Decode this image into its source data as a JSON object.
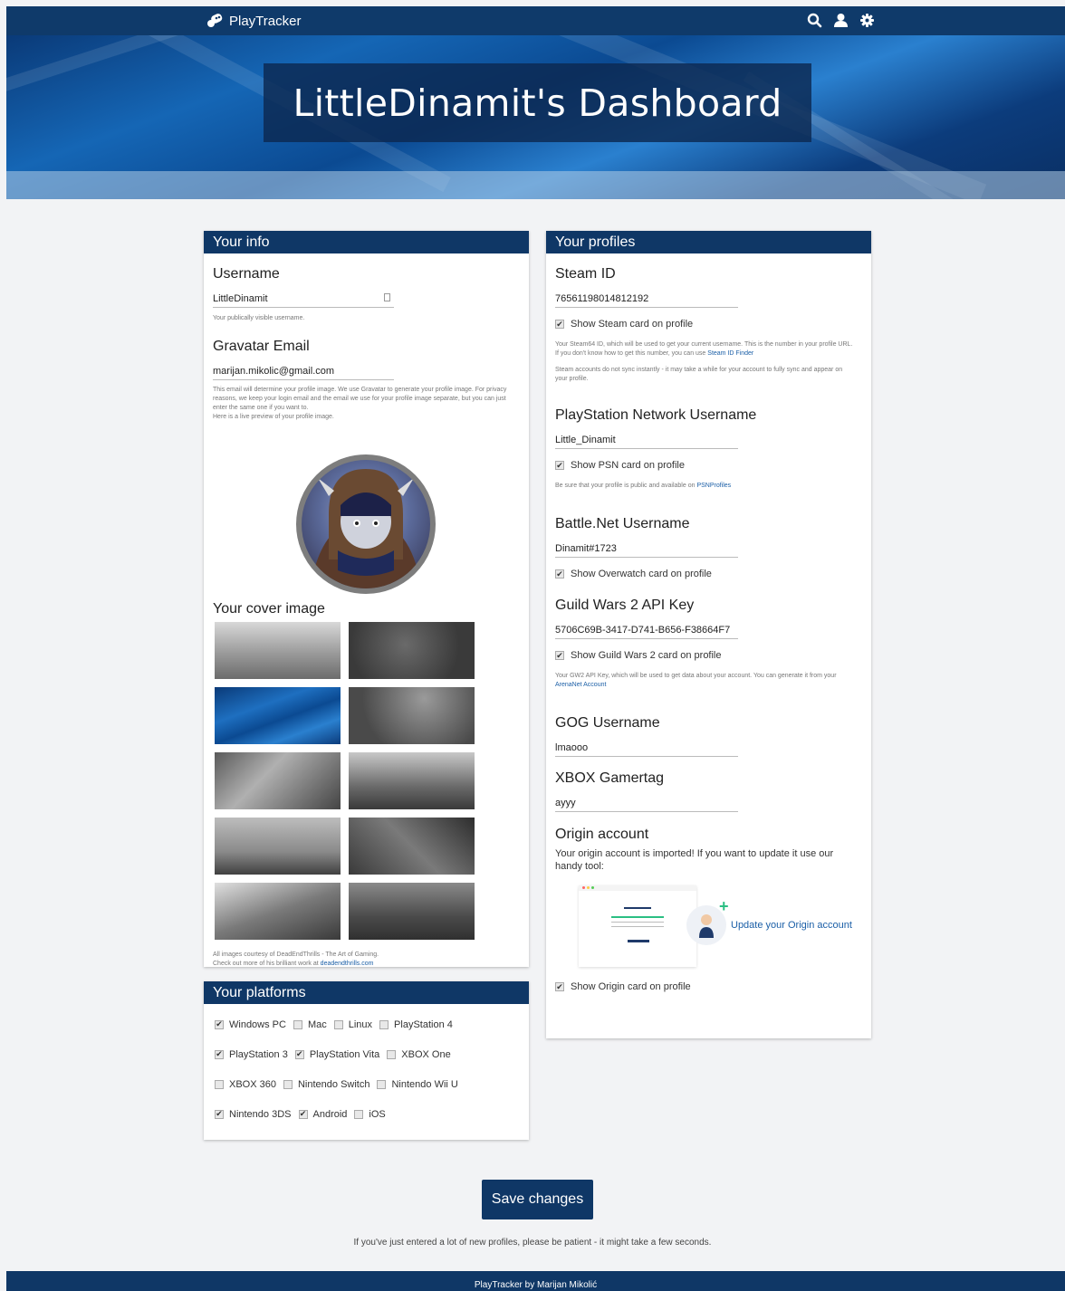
{
  "nav": {
    "brand": "PlayTracker"
  },
  "hero": {
    "title": "LittleDinamit's Dashboard"
  },
  "your_info": {
    "heading": "Your info",
    "username_label": "Username",
    "username_value": "LittleDinamit",
    "username_help": "Your publically visible username.",
    "gravatar_label": "Gravatar Email",
    "gravatar_value": "marijan.mikolic@gmail.com",
    "gravatar_help": "This email will determine your profile image. We use Gravatar to generate your profile image. For privacy reasons, we keep your login email and the email we use for your profile image separate, but you can just enter the same one if you want to.",
    "gravatar_help2": "Here is a live preview of your profile image.",
    "cover_label": "Your cover image",
    "cover_credit1": "All images courtesy of DeadEndThrills - The Art of Gaming.",
    "cover_credit2": "Check out more of his brilliant work at ",
    "cover_credit_link": "deadendthrills.com"
  },
  "your_platforms": {
    "heading": "Your platforms",
    "rows": [
      [
        {
          "label": "Windows PC",
          "checked": true
        },
        {
          "label": "Mac",
          "checked": false
        },
        {
          "label": "Linux",
          "checked": false
        },
        {
          "label": "PlayStation 4",
          "checked": false
        }
      ],
      [
        {
          "label": "PlayStation 3",
          "checked": true
        },
        {
          "label": "PlayStation Vita",
          "checked": true
        },
        {
          "label": "XBOX One",
          "checked": false
        }
      ],
      [
        {
          "label": "XBOX 360",
          "checked": false
        },
        {
          "label": "Nintendo Switch",
          "checked": false
        },
        {
          "label": "Nintendo Wii U",
          "checked": false
        }
      ],
      [
        {
          "label": "Nintendo 3DS",
          "checked": true
        },
        {
          "label": "Android",
          "checked": true
        },
        {
          "label": "iOS",
          "checked": false
        }
      ]
    ]
  },
  "your_profiles": {
    "heading": "Your profiles",
    "steam_label": "Steam ID",
    "steam_value": "76561198014812192",
    "steam_check": "Show Steam card on profile",
    "steam_help1": "Your Steam64 ID, which will be used to get your current username. This is the number in your profile URL. If you don't know how to get this number, you can use ",
    "steam_help_link": "Steam ID Finder",
    "steam_help2": "Steam accounts do not sync instantly - it may take a while for your account to fully sync and appear on your profile.",
    "psn_label": "PlayStation Network Username",
    "psn_value": "Little_Dinamit",
    "psn_check": "Show PSN card on profile",
    "psn_help": "Be sure that your profile is public and available on ",
    "psn_help_link": "PSNProfiles",
    "bnet_label": "Battle.Net Username",
    "bnet_value": "Dinamit#1723",
    "bnet_check": "Show Overwatch card on profile",
    "gw2_label": "Guild Wars 2 API Key",
    "gw2_value": "5706C69B-3417-D741-B656-F38664F7",
    "gw2_check": "Show Guild Wars 2 card on profile",
    "gw2_help": "Your GW2 API Key, which will be used to get data about your account. You can generate it from your ",
    "gw2_help_link": "ArenaNet Account",
    "gog_label": "GOG Username",
    "gog_value": "lmaooo",
    "xbox_label": "XBOX Gamertag",
    "xbox_value": "ayyy",
    "origin_label": "Origin account",
    "origin_text": "Your origin account is imported! If you want to update it use our handy tool:",
    "origin_update": "Update your Origin account",
    "origin_check": "Show Origin card on profile"
  },
  "actions": {
    "save": "Save changes",
    "patience": "If you've just entered a lot of new profiles, please be patient - it might take a few seconds."
  },
  "footer": {
    "text": "PlayTracker by Marijan Mikolić"
  },
  "colors": {
    "primary": "#0f3766",
    "accent_green": "#2bbf83",
    "link": "#1b5fa7"
  }
}
